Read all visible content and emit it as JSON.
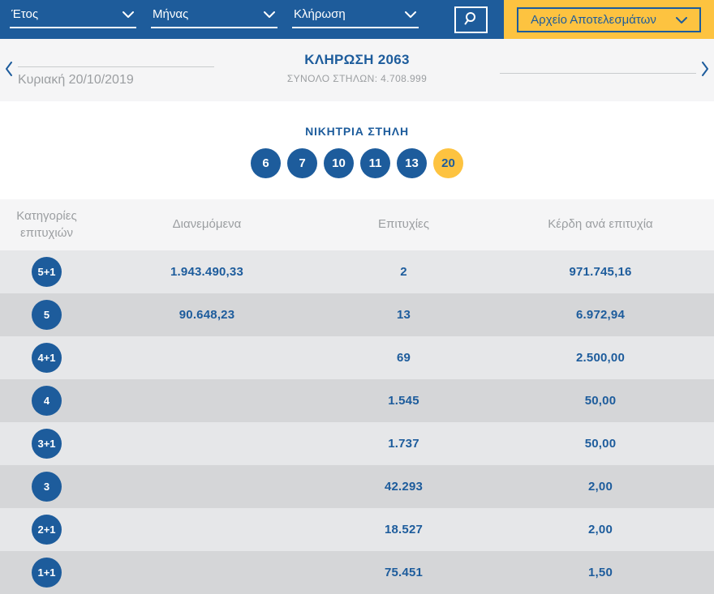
{
  "topbar": {
    "filters": [
      {
        "label": "Έτος"
      },
      {
        "label": "Μήνας"
      },
      {
        "label": "Κλήρωση"
      }
    ],
    "archive_button": "Αρχείο Αποτελεσμάτων"
  },
  "draw_nav": {
    "date": "Κυριακή 20/10/2019",
    "title": "ΚΛΗΡΩΣΗ 2063",
    "subtitle": "ΣΥΝΟΛΟ ΣΤΗΛΩΝ: 4.708.999"
  },
  "winning_column": {
    "heading": "ΝΙΚΗΤΡΙΑ ΣΤΗΛΗ",
    "numbers": [
      6,
      7,
      10,
      11,
      13
    ],
    "joker": 20
  },
  "results_table": {
    "headers": [
      "Κατηγορίες επιτυχιών",
      "Διανεμόμενα",
      "Επιτυχίες",
      "Κέρδη ανά επιτυχία"
    ],
    "rows": [
      {
        "category": "5+1",
        "distributed": "1.943.490,33",
        "winners": "2",
        "per_winner": "971.745,16"
      },
      {
        "category": "5",
        "distributed": "90.648,23",
        "winners": "13",
        "per_winner": "6.972,94"
      },
      {
        "category": "4+1",
        "distributed": "",
        "winners": "69",
        "per_winner": "2.500,00"
      },
      {
        "category": "4",
        "distributed": "",
        "winners": "1.545",
        "per_winner": "50,00"
      },
      {
        "category": "3+1",
        "distributed": "",
        "winners": "1.737",
        "per_winner": "50,00"
      },
      {
        "category": "3",
        "distributed": "",
        "winners": "42.293",
        "per_winner": "2,00"
      },
      {
        "category": "2+1",
        "distributed": "",
        "winners": "18.527",
        "per_winner": "2,00"
      },
      {
        "category": "1+1",
        "distributed": "",
        "winners": "75.451",
        "per_winner": "1,50"
      }
    ]
  },
  "colors": {
    "bar_blue": "#1e5c9b",
    "accent_blue": "#1d5c9c",
    "accent_yellow": "#fdc340",
    "muted_gray": "#9b9ea1",
    "row_light": "#e6e7e9",
    "row_dark": "#d5d6d8",
    "strip_gray": "#f5f5f6"
  }
}
